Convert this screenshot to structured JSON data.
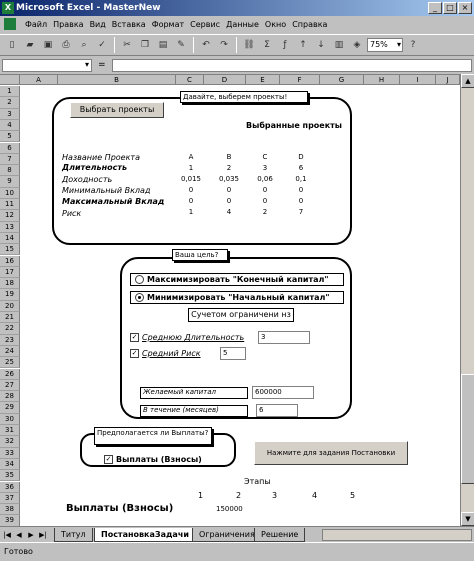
{
  "window": {
    "title": "Microsoft Excel - MasterNew",
    "logo_icon": "excel-logo-icon",
    "min": "_",
    "max": "□",
    "close": "×"
  },
  "menu": [
    "Файл",
    "Правка",
    "Вид",
    "Вставка",
    "Формат",
    "Сервис",
    "Данные",
    "Окно",
    "Справка"
  ],
  "toolbar": {
    "zoom": "75%"
  },
  "formula": {
    "eq": "="
  },
  "columns": [
    "A",
    "B",
    "C",
    "D",
    "E",
    "F",
    "G",
    "H",
    "I",
    "J"
  ],
  "rows": [
    "1",
    "2",
    "3",
    "4",
    "5",
    "6",
    "7",
    "8",
    "9",
    "10",
    "11",
    "12",
    "13",
    "14",
    "15",
    "16",
    "17",
    "18",
    "19",
    "20",
    "21",
    "22",
    "23",
    "24",
    "25",
    "26",
    "27",
    "28",
    "29",
    "30",
    "31",
    "32",
    "33",
    "34",
    "35",
    "36",
    "37",
    "38",
    "39"
  ],
  "project_box": {
    "select_button": "Выбрать проекты",
    "callout": "Давайте, выберем проекты!",
    "selected_title": "Выбранные проекты",
    "labels": [
      "Название Проекта",
      "Длительность",
      "Доходность",
      "Минимальный Вклад",
      "Максимальный Вклад",
      "Риск"
    ],
    "columns": [
      [
        "A",
        "1",
        "0,015",
        "0",
        "0",
        "1"
      ],
      [
        "B",
        "2",
        "0,035",
        "0",
        "0",
        "4"
      ],
      [
        "C",
        "3",
        "0,06",
        "0",
        "0",
        "2"
      ],
      [
        "D",
        "6",
        "0,1",
        "0",
        "0",
        "7"
      ]
    ]
  },
  "goal_box": {
    "callout": "Ваша цель?",
    "option1": "Максимизировать \"Конечный капитал\"",
    "option2": "Минимизировать \"Начальный капитал\"",
    "constraints_title": "Сучетом ограничени нз",
    "chk1_label": "Среднюю Длительность",
    "chk1_value": "3",
    "chk2_label": "Средний Риск",
    "chk2_value": "5",
    "capital_label": "Желаемый капитал",
    "capital_value": "600000",
    "months_label": "В течение (месяцев)",
    "months_value": "6"
  },
  "payments_box": {
    "callout": "Предполагается ли Выплаты?",
    "chk_label": "Выплаты (Взносы)"
  },
  "problem_button": "Нажмите для задания Постановки",
  "stages": {
    "title": "Этапы",
    "numbers": [
      "1",
      "2",
      "3",
      "4",
      "5"
    ],
    "row_label": "Выплаты (Взносы)",
    "first_value": "150000"
  },
  "tabs": [
    "Титул",
    "ПостановкаЗадачи",
    "Ограничения",
    "Решение"
  ],
  "status": "Готово"
}
